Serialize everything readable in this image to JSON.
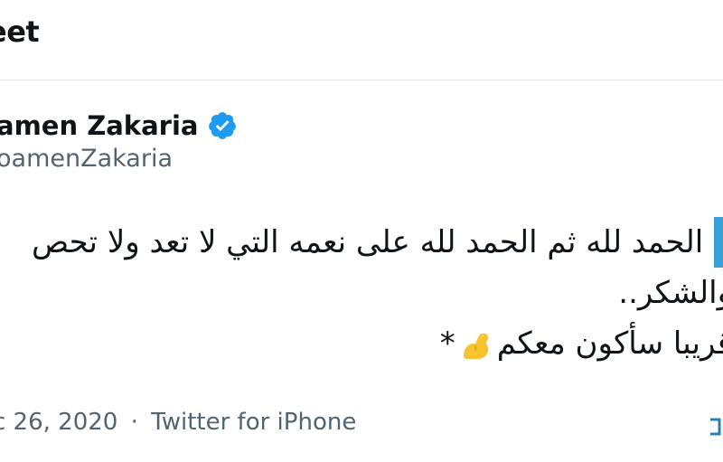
{
  "header": {
    "title": "eet"
  },
  "author": {
    "name": "amen Zakaria",
    "handle": "oamenZakaria",
    "verified_icon": "verified-badge-icon",
    "verified_color": "#1d9bf0"
  },
  "tweet": {
    "lines": [
      "م الحمد لله ثم الحمد لله على نعمه التي لا تعد ولا تحص",
      "والشكر..",
      "قريبا سأكون معكم"
    ],
    "emoji": "flexed-biceps-icon",
    "trailing_star": "*"
  },
  "meta": {
    "date": "c 26, 2020",
    "separator": "·",
    "source": "Twitter for iPhone"
  }
}
